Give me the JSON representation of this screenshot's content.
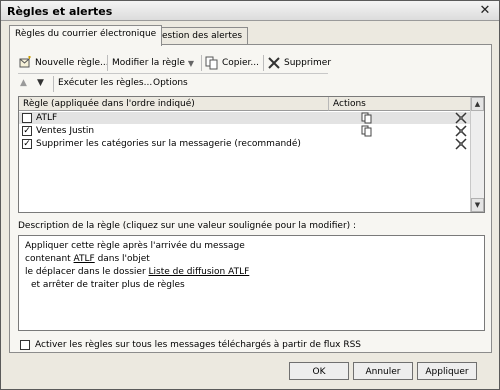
{
  "window": {
    "title": "Règles et alertes"
  },
  "tabs": [
    {
      "label": "Règles du courrier électronique",
      "active": true
    },
    {
      "label": "Gestion des alertes",
      "active": false
    }
  ],
  "toolbar": {
    "new_rule": "Nouvelle règle...",
    "modify_rule": "Modifier la règle",
    "copy": "Copier...",
    "delete": "Supprimer",
    "run_rules": "Exécuter les règles...",
    "options": "Options"
  },
  "rules_table": {
    "columns": [
      "Règle (appliquée dans l'ordre indiqué)",
      "Actions"
    ],
    "rows": [
      {
        "name": "ATLF",
        "checked": false,
        "selected": true
      },
      {
        "name": "Ventes Justin",
        "checked": true,
        "selected": false
      },
      {
        "name": "Supprimer les catégories sur la messagerie (recommandé)",
        "checked": true,
        "selected": false
      }
    ]
  },
  "description": {
    "label": "Description de la règle (cliquez sur une valeur soulignée pour la modifier) :",
    "line1": "Appliquer cette règle après l'arrivée du message",
    "line2_pre": "contenant ",
    "line2_link": "ATLF",
    "line2_post": " dans l'objet",
    "line3_pre": "le déplacer dans le dossier ",
    "line3_link": "Liste de diffusion ATLF",
    "line4": "et arrêter de traiter plus de règles"
  },
  "rss_option": {
    "label": "Activer les règles sur tous les messages téléchargés à partir de flux RSS",
    "checked": false
  },
  "buttons": {
    "ok": "OK",
    "cancel": "Annuler",
    "apply": "Appliquer"
  },
  "colors": {
    "selected_row": "#e3e3e3",
    "dialog_bg": "#ece9e0"
  },
  "icons": [
    "close-icon",
    "new-rule-icon",
    "copy-icon",
    "delete-icon",
    "move-up-icon",
    "move-down-icon",
    "action-move-icon",
    "action-stop-icon"
  ]
}
